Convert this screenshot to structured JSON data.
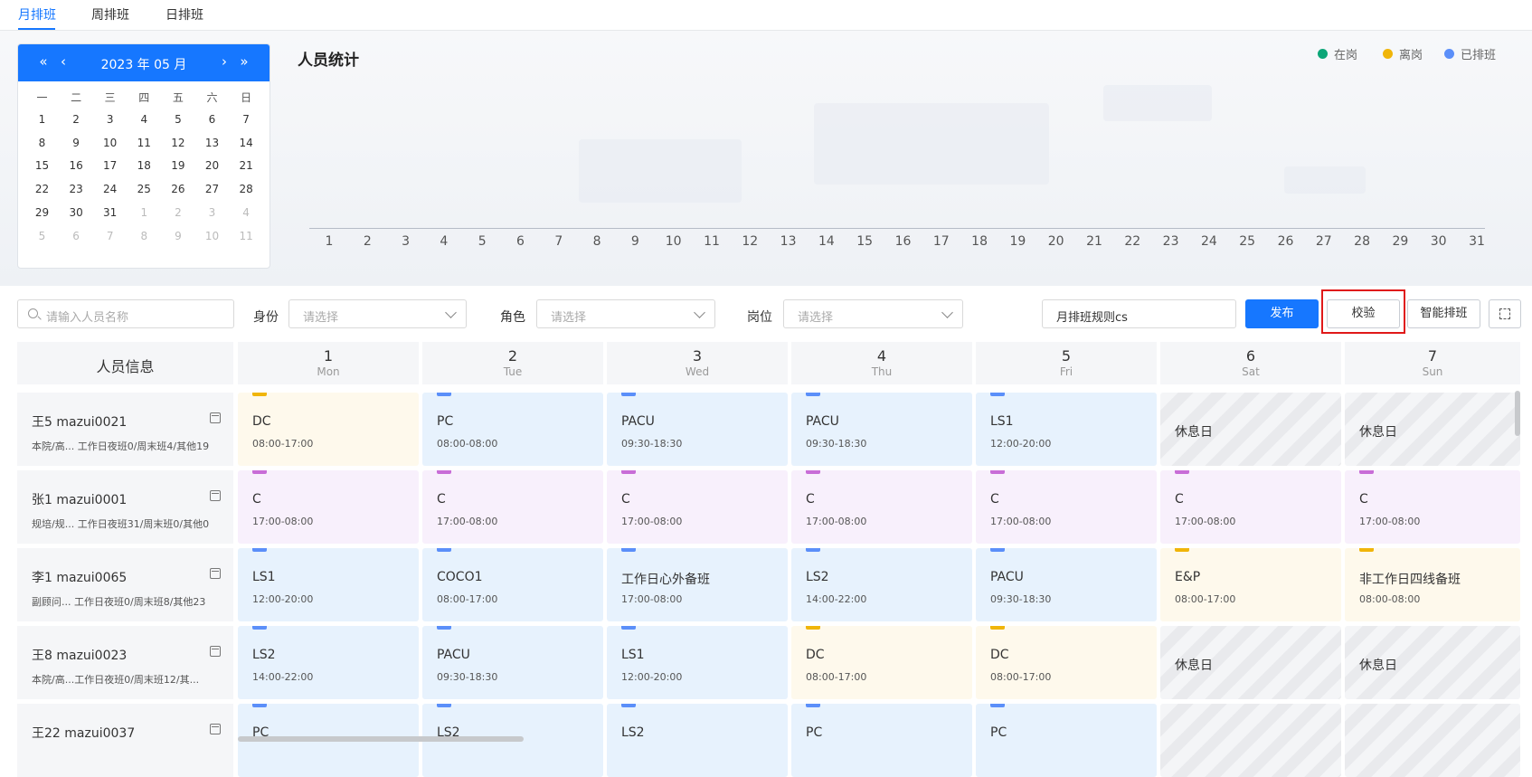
{
  "tabs": [
    "月排班",
    "周排班",
    "日排班"
  ],
  "calendar": {
    "title": "2023 年 05 月",
    "weekdays": [
      "一",
      "二",
      "三",
      "四",
      "五",
      "六",
      "日"
    ],
    "weeks": [
      [
        "1",
        "2",
        "3",
        "4",
        "5",
        "6",
        "7"
      ],
      [
        "8",
        "9",
        "10",
        "11",
        "12",
        "13",
        "14"
      ],
      [
        "15",
        "16",
        "17",
        "18",
        "19",
        "20",
        "21"
      ],
      [
        "22",
        "23",
        "24",
        "25",
        "26",
        "27",
        "28"
      ],
      [
        "29",
        "30",
        "31",
        "1",
        "2",
        "3",
        "4"
      ],
      [
        "5",
        "6",
        "7",
        "8",
        "9",
        "10",
        "11"
      ]
    ],
    "muted_from_index": 31
  },
  "stats": {
    "title": "人员统计",
    "legend": [
      {
        "label": "在岗",
        "color": "#0ca678"
      },
      {
        "label": "离岗",
        "color": "#f0b50a"
      },
      {
        "label": "已排班",
        "color": "#5b8ff9"
      }
    ],
    "axis_labels": [
      "1",
      "2",
      "3",
      "4",
      "5",
      "6",
      "7",
      "8",
      "9",
      "10",
      "11",
      "12",
      "13",
      "14",
      "15",
      "16",
      "17",
      "18",
      "19",
      "20",
      "21",
      "22",
      "23",
      "24",
      "25",
      "26",
      "27",
      "28",
      "29",
      "30",
      "31"
    ]
  },
  "filters": {
    "search_placeholder": "请输入人员名称",
    "identity_label": "身份",
    "role_label": "角色",
    "post_label": "岗位",
    "select_placeholder": "请选择",
    "rule_value": "月排班规则cs"
  },
  "buttons": {
    "publish": "发布",
    "verify": "校验",
    "smart": "智能排班"
  },
  "table": {
    "person_header": "人员信息",
    "days": [
      {
        "num": "1",
        "wd": "Mon"
      },
      {
        "num": "2",
        "wd": "Tue"
      },
      {
        "num": "3",
        "wd": "Wed"
      },
      {
        "num": "4",
        "wd": "Thu"
      },
      {
        "num": "5",
        "wd": "Fri"
      },
      {
        "num": "6",
        "wd": "Sat"
      },
      {
        "num": "7",
        "wd": "Sun"
      }
    ],
    "rows": [
      {
        "name": "王5 mazui0021",
        "info": "本院/高... 工作日夜班0/周末班4/其他19",
        "shifts": [
          {
            "name": "DC",
            "time": "08:00-17:00",
            "color": "yellow"
          },
          {
            "name": "PC",
            "time": "08:00-08:00",
            "color": "blue"
          },
          {
            "name": "PACU",
            "time": "09:30-18:30",
            "color": "blue"
          },
          {
            "name": "PACU",
            "time": "09:30-18:30",
            "color": "blue"
          },
          {
            "name": "LS1",
            "time": "12:00-20:00",
            "color": "blue"
          },
          {
            "rest": "休息日"
          },
          {
            "rest": "休息日"
          }
        ]
      },
      {
        "name": "张1 mazui0001",
        "info": "规培/规... 工作日夜班31/周末班0/其他0",
        "shifts": [
          {
            "name": "C",
            "time": "17:00-08:00",
            "color": "purple"
          },
          {
            "name": "C",
            "time": "17:00-08:00",
            "color": "purple"
          },
          {
            "name": "C",
            "time": "17:00-08:00",
            "color": "purple"
          },
          {
            "name": "C",
            "time": "17:00-08:00",
            "color": "purple"
          },
          {
            "name": "C",
            "time": "17:00-08:00",
            "color": "purple"
          },
          {
            "name": "C",
            "time": "17:00-08:00",
            "color": "purple"
          },
          {
            "name": "C",
            "time": "17:00-08:00",
            "color": "purple"
          }
        ]
      },
      {
        "name": "李1 mazui0065",
        "info": "副顾问... 工作日夜班0/周末班8/其他23",
        "shifts": [
          {
            "name": "LS1",
            "time": "12:00-20:00",
            "color": "blue"
          },
          {
            "name": "COCO1",
            "time": "08:00-17:00",
            "color": "blue"
          },
          {
            "name": "工作日心外备班",
            "time": "17:00-08:00",
            "color": "blue"
          },
          {
            "name": "LS2",
            "time": "14:00-22:00",
            "color": "blue"
          },
          {
            "name": "PACU",
            "time": "09:30-18:30",
            "color": "blue"
          },
          {
            "name": "E&P",
            "time": "08:00-17:00",
            "color": "yellow"
          },
          {
            "name": "非工作日四线备班",
            "time": "08:00-08:00",
            "color": "yellow"
          }
        ]
      },
      {
        "name": "王8 mazui0023",
        "info": "本院/高...工作日夜班0/周末班12/其...",
        "shifts": [
          {
            "name": "LS2",
            "time": "14:00-22:00",
            "color": "blue"
          },
          {
            "name": "PACU",
            "time": "09:30-18:30",
            "color": "blue"
          },
          {
            "name": "LS1",
            "time": "12:00-20:00",
            "color": "blue"
          },
          {
            "name": "DC",
            "time": "08:00-17:00",
            "color": "yellow"
          },
          {
            "name": "DC",
            "time": "08:00-17:00",
            "color": "yellow"
          },
          {
            "rest": "休息日"
          },
          {
            "rest": "休息日"
          }
        ]
      },
      {
        "name": "王22 mazui0037",
        "info": "",
        "shifts": [
          {
            "name": "PC",
            "time": "",
            "color": "blue"
          },
          {
            "name": "LS2",
            "time": "",
            "color": "blue"
          },
          {
            "name": "LS2",
            "time": "",
            "color": "blue"
          },
          {
            "name": "PC",
            "time": "",
            "color": "blue"
          },
          {
            "name": "PC",
            "time": "",
            "color": "blue"
          },
          {
            "rest": ""
          },
          {
            "rest": ""
          }
        ]
      }
    ]
  }
}
